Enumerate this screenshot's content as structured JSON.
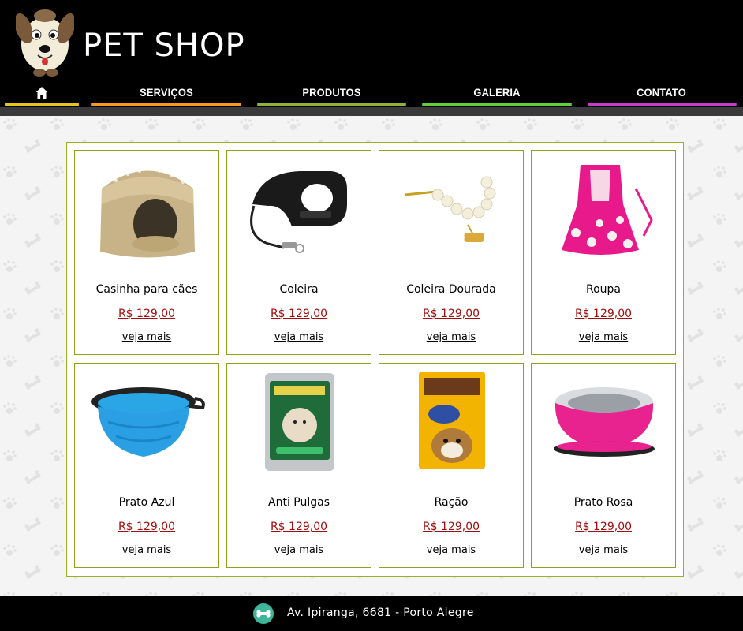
{
  "header": {
    "brand": "PET SHOP",
    "logo_icon": "dog-face-icon"
  },
  "nav": {
    "home_icon": "home-icon",
    "items": [
      {
        "label": "SERVIÇOS",
        "color": "#f39a1f"
      },
      {
        "label": "PRODUTOS",
        "color": "#8fb23a"
      },
      {
        "label": "GALERIA",
        "color": "#5fcf3a"
      },
      {
        "label": "CONTATO",
        "color": "#c43bc9"
      }
    ],
    "home_color": "#e6c21e"
  },
  "products": [
    {
      "name": "Casinha para cães",
      "price": "R$ 129,00",
      "more": "veja mais",
      "icon": "dog-bed-icon"
    },
    {
      "name": "Coleira",
      "price": "R$ 129,00",
      "more": "veja mais",
      "icon": "retractable-leash-icon"
    },
    {
      "name": "Coleira Dourada",
      "price": "R$ 129,00",
      "more": "veja mais",
      "icon": "pearl-collar-icon"
    },
    {
      "name": "Roupa",
      "price": "R$ 129,00",
      "more": "veja mais",
      "icon": "dog-dress-icon"
    },
    {
      "name": "Prato Azul",
      "price": "R$ 129,00",
      "more": "veja mais",
      "icon": "blue-bowl-icon"
    },
    {
      "name": "Anti Pulgas",
      "price": "R$ 129,00",
      "more": "veja mais",
      "icon": "flea-treatment-icon"
    },
    {
      "name": "Ração",
      "price": "R$ 129,00",
      "more": "veja mais",
      "icon": "dog-food-pouch-icon"
    },
    {
      "name": "Prato Rosa",
      "price": "R$ 129,00",
      "more": "veja mais",
      "icon": "pink-bowl-icon"
    }
  ],
  "footer": {
    "address": "Av. Ipiranga, 6681 - Porto Alegre",
    "icon": "bone-icon"
  },
  "colors": {
    "panel_border": "#9cae22",
    "price": "#a00e0e",
    "footer_icon_bg": "#3fb59a"
  }
}
